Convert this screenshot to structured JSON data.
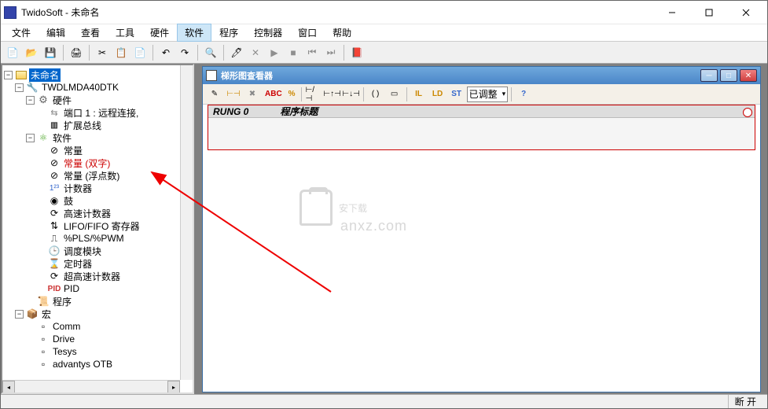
{
  "window": {
    "app_name": "TwidoSoft",
    "title_suffix": "未命名",
    "title": "TwidoSoft - 未命名"
  },
  "menu": {
    "file": "文件",
    "edit": "编辑",
    "view": "查看",
    "tool": "工具",
    "hardware": "硬件",
    "software": "软件",
    "program": "程序",
    "controller": "控制器",
    "window": "窗口",
    "help": "帮助"
  },
  "tree": {
    "root": "未命名",
    "device": "TWDLMDA40DTK",
    "hardware": "硬件",
    "port1": "端口 1 : 远程连接,",
    "expansion_bus": "扩展总线",
    "software": "软件",
    "constant": "常量",
    "constant_dword": "常量 (双字)",
    "constant_float": "常量 (浮点数)",
    "counter": "计数器",
    "drum": "鼓",
    "high_speed_counter": "高速计数器",
    "lifo_fifo": "LIFO/FIFO 寄存器",
    "pls_pwm": "%PLS/%PWM",
    "schedule": "调度模块",
    "timer": "定时器",
    "very_high_speed_counter": "超高速计数器",
    "pid": "PID",
    "program": "程序",
    "macro": "宏",
    "comm": "Comm",
    "drive": "Drive",
    "tesys": "Tesys",
    "advantys": "advantys OTB"
  },
  "child": {
    "title": "梯形图查看器",
    "combo": "已调整",
    "abc": "ABC",
    "percent": "%",
    "rung_label": "RUNG 0",
    "rung_name": "程序标题"
  },
  "status": {
    "right": "断 开"
  },
  "watermark": {
    "main": "安下载",
    "sub": "anxz.com"
  }
}
